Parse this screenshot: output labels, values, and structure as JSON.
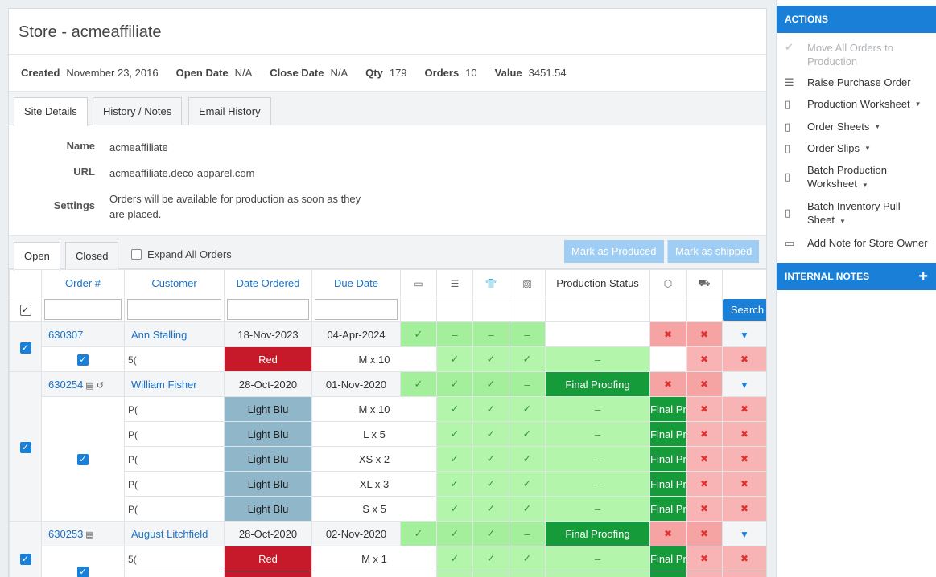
{
  "store": {
    "title": "Store - acmeaffiliate"
  },
  "summary": [
    {
      "label": "Created",
      "value": "November 23, 2016"
    },
    {
      "label": "Open Date",
      "value": "N/A"
    },
    {
      "label": "Close Date",
      "value": "N/A"
    },
    {
      "label": "Qty",
      "value": "179"
    },
    {
      "label": "Orders",
      "value": "10"
    },
    {
      "label": "Value",
      "value": "3451.54"
    }
  ],
  "tabs": [
    "Site Details",
    "History / Notes",
    "Email History"
  ],
  "details": {
    "name_label": "Name",
    "name": "acmeaffiliate",
    "url_label": "URL",
    "url": "acmeaffiliate.deco-apparel.com",
    "settings_label": "Settings",
    "settings": "Orders will be available for production as soon as they are placed."
  },
  "order_tabs": {
    "open": "Open",
    "closed": "Closed",
    "expand_all": "Expand All Orders",
    "mark_produced": "Mark as Produced",
    "mark_shipped": "Mark as shipped"
  },
  "columns": {
    "order": "Order #",
    "customer": "Customer",
    "date_ordered": "Date Ordered",
    "due_date": "Due Date",
    "production_status": "Production Status",
    "search": "Search"
  },
  "orders": [
    {
      "id": "630307",
      "customer": "Ann Stalling",
      "date_ordered": "18-Nov-2023",
      "due_date": "04-Apr-2024",
      "status": ""
    },
    {
      "id": "630254",
      "customer": "William Fisher",
      "date_ordered": "28-Oct-2020",
      "due_date": "01-Nov-2020",
      "status": "Final Proofing"
    },
    {
      "id": "630253",
      "customer": "August Litchfield",
      "date_ordered": "28-Oct-2020",
      "due_date": "02-Nov-2020",
      "status": "Final Proofing"
    }
  ],
  "lines": [
    {
      "sku": "5(",
      "color": "Red",
      "size": "M x 10",
      "status": ""
    },
    {
      "sku": "P(",
      "color": "Light Blu",
      "size": "M x 10",
      "status": "Final Proofing"
    },
    {
      "sku": "P(",
      "color": "Light Blu",
      "size": "L x 5",
      "status": "Final Proofing"
    },
    {
      "sku": "P(",
      "color": "Light Blu",
      "size": "XS x 2",
      "status": "Final Proofing"
    },
    {
      "sku": "P(",
      "color": "Light Blu",
      "size": "XL x 3",
      "status": "Final Proofing"
    },
    {
      "sku": "P(",
      "color": "Light Blu",
      "size": "S x 5",
      "status": "Final Proofing"
    },
    {
      "sku": "5(",
      "color": "Red",
      "size": "M x 1",
      "status": "Final Proofing"
    }
  ],
  "sidebar": {
    "actions_title": "ACTIONS",
    "items": [
      "Move All Orders to Production",
      "Raise Purchase Order",
      "Production Worksheet",
      "Order Sheets",
      "Order Slips",
      "Batch Production Worksheet",
      "Batch Inventory Pull Sheet",
      "Add Note for Store Owner"
    ],
    "notes_title": "INTERNAL NOTES"
  },
  "colors": {
    "accent": "#1a7fd6",
    "status_green": "#159b39",
    "light_blue": "#8fb6c9",
    "red": "#c61a2a"
  }
}
